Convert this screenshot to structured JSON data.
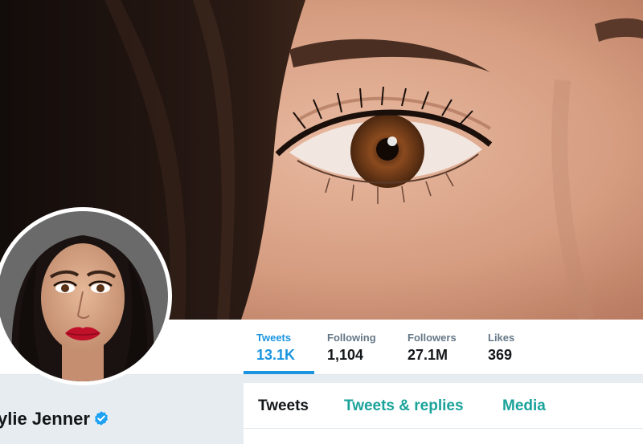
{
  "profile": {
    "name": "ylie Jenner",
    "verified": true
  },
  "stats": [
    {
      "label": "Tweets",
      "value": "13.1K",
      "active": true
    },
    {
      "label": "Following",
      "value": "1,104",
      "active": false
    },
    {
      "label": "Followers",
      "value": "27.1M",
      "active": false
    },
    {
      "label": "Likes",
      "value": "369",
      "active": false
    }
  ],
  "tabs": [
    {
      "label": "Tweets",
      "active": true
    },
    {
      "label": "Tweets & replies",
      "active": false
    },
    {
      "label": "Media",
      "active": false
    }
  ],
  "icons": {
    "verified": "verified-badge-icon"
  },
  "colors": {
    "accent": "#1b95e0",
    "tab_link": "#1aa39a",
    "text": "#14171a",
    "muted": "#657786",
    "page_bg": "#e6ecf0"
  }
}
